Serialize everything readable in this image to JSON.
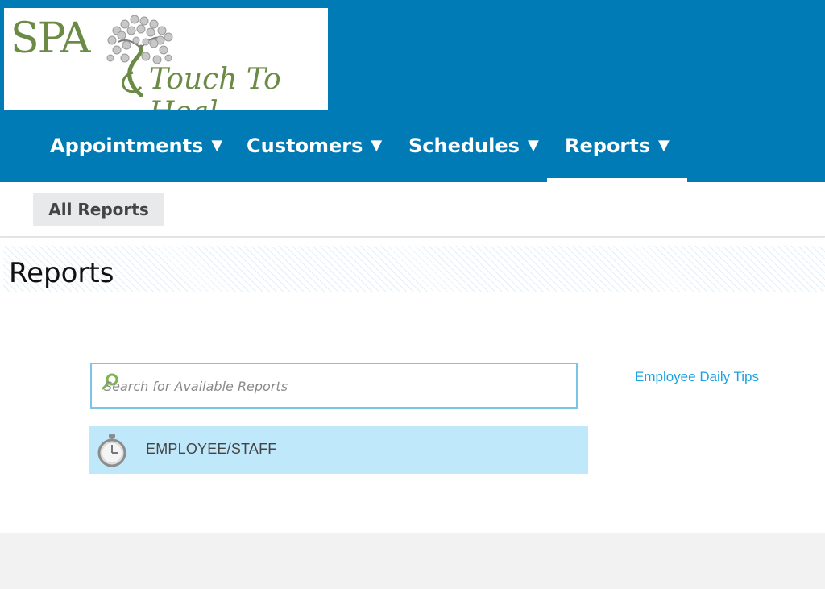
{
  "logo": {
    "brand": "SPA",
    "tagline": "Touch To Heal"
  },
  "nav": {
    "items": [
      {
        "label": "Appointments",
        "arrow": "▼"
      },
      {
        "label": "Customers",
        "arrow": "▼"
      },
      {
        "label": "Schedules",
        "arrow": "▼"
      },
      {
        "label": "Reports",
        "arrow": "▼",
        "active": true
      }
    ]
  },
  "subnav": {
    "all_reports_label": "All Reports"
  },
  "page": {
    "title": "Reports"
  },
  "search": {
    "placeholder": "Search for Available Reports",
    "value": ""
  },
  "links": {
    "employee_daily_tips": "Employee Daily Tips"
  },
  "categories": [
    {
      "label": "EMPLOYEE/STAFF",
      "icon": "stopwatch-icon"
    }
  ],
  "colors": {
    "header_bg": "#007bb6",
    "link": "#1aa3e0",
    "category_bg": "#bfe9fa",
    "search_border": "#7cc4e6",
    "logo_green": "#6b8a45"
  }
}
